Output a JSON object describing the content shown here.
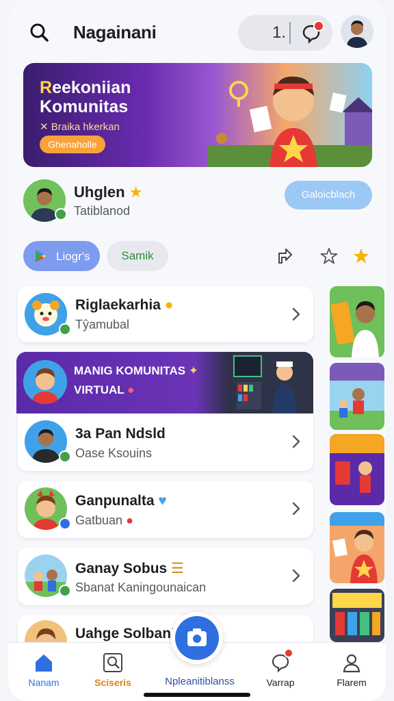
{
  "header": {
    "title": "Nagainani",
    "count": "1.",
    "search_icon": "search-icon",
    "chat_icon": "chat-bubble-icon"
  },
  "banner": {
    "title_first": "R",
    "title_line1_rest": "eekoniian",
    "title_line2": "Komunitas",
    "subtitle": "✕ Braika hkerkan",
    "button": "Ghenaholle"
  },
  "profile": {
    "name": "Uhglen",
    "subtitle": "Tatiblanod",
    "button": "Galoicblach"
  },
  "chips": {
    "primary": "Liogr's",
    "secondary": "Samik"
  },
  "list": [
    {
      "title": "Riglaekarhia",
      "subtitle": "Tŷamubal"
    },
    {
      "title": "3a Pan Ndsld",
      "subtitle": "Oase Ksouins"
    },
    {
      "title": "Ganpunalta",
      "subtitle": "Gatbuan"
    },
    {
      "title": "Ganay Sobus",
      "subtitle": "Sbanat Kaningounaican"
    },
    {
      "title": "Uahge Solban!"
    }
  ],
  "promo": {
    "line1": "MANIG KOMUNITAS",
    "line2": "VIRTUAL"
  },
  "nav": {
    "home": "Nanam",
    "search": "Sciseris",
    "center": "Npleanitiblanss",
    "activity": "Varrap",
    "profile": "Flarem"
  },
  "colors": {
    "accent": "#2f6fe0",
    "chip_primary": "#7d9bef",
    "profile_button": "#9cc8f5",
    "banner_button": "#f7a23a",
    "badge_green": "#43a047",
    "notification_red": "#e53935"
  }
}
